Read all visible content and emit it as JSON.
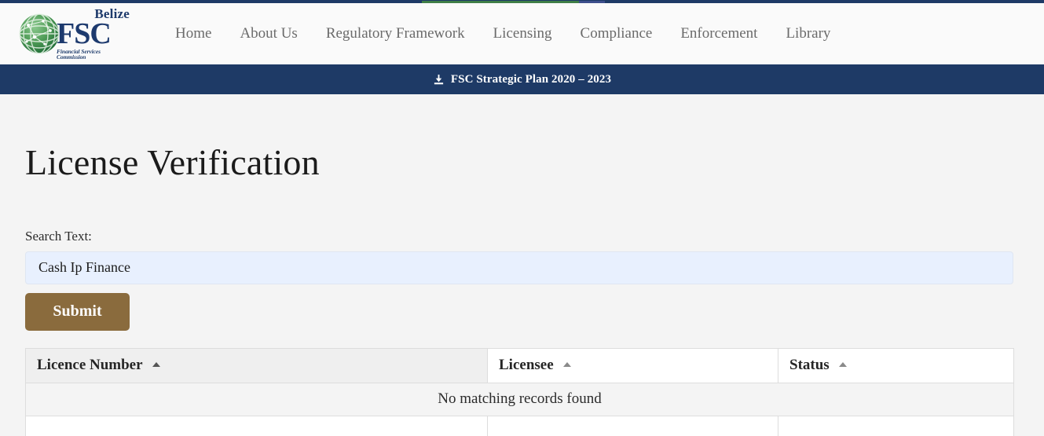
{
  "top_strip": {
    "background_color": "#1e3a66",
    "progress_green_color": "#3f7e47",
    "progress_blue_color": "#3d4e8c"
  },
  "header": {
    "logo": {
      "belize_text": "Belize",
      "acronym_text": "FSC",
      "tagline_text": "Financial Services Commission",
      "globe_color": "#3f8b4d",
      "text_color": "#1d3a6e"
    },
    "nav": {
      "items": [
        {
          "label": "Home"
        },
        {
          "label": "About Us"
        },
        {
          "label": "Regulatory Framework"
        },
        {
          "label": "Licensing"
        },
        {
          "label": "Compliance"
        },
        {
          "label": "Enforcement"
        },
        {
          "label": "Library"
        }
      ]
    }
  },
  "announcement": {
    "icon": "download-icon",
    "label": "FSC Strategic Plan 2020 – 2023",
    "background_color": "#1e3a66",
    "text_color": "#ffffff"
  },
  "main": {
    "page_title": "License Verification",
    "search": {
      "label": "Search Text:",
      "value": "Cash Ip Finance",
      "placeholder": "",
      "field_background_color": "#e8f0fe",
      "submit_label": "Submit",
      "submit_color": "#8a6b3d"
    },
    "results_table": {
      "columns": [
        {
          "label": "Licence Number",
          "sort": "asc",
          "active": true
        },
        {
          "label": "Licensee",
          "sort": "asc",
          "active": false
        },
        {
          "label": "Status",
          "sort": "asc",
          "active": false
        }
      ],
      "empty_message": "No matching records found",
      "rows": []
    }
  }
}
